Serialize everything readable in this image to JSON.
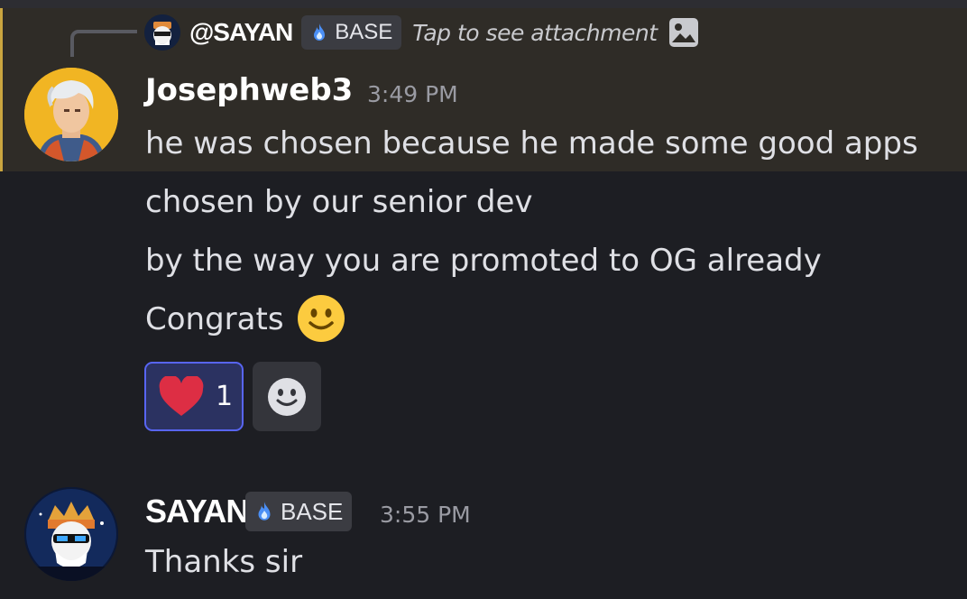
{
  "reply": {
    "author": "@SAYAN",
    "badge": "BASE",
    "preview": "Tap to see attachment",
    "icon": "image-icon"
  },
  "messages": [
    {
      "author": "Josephweb3",
      "time": "3:49 PM",
      "lines": [
        "he was chosen because he made some good apps",
        "chosen by our senior dev",
        "by the way you are promoted to OG already",
        "Congrats"
      ],
      "emoji": "slightly-smiling-face",
      "reactions": [
        {
          "emoji": "heart",
          "count": "1"
        }
      ]
    },
    {
      "author": "SAYAN",
      "badge": "BASE",
      "time": "3:55 PM",
      "lines": [
        "Thanks sir"
      ]
    }
  ],
  "colors": {
    "background": "#1d1e23",
    "highlight": "#2f2c27",
    "highlight_bar": "#caa53f",
    "reaction_active_border": "#5865f2"
  }
}
